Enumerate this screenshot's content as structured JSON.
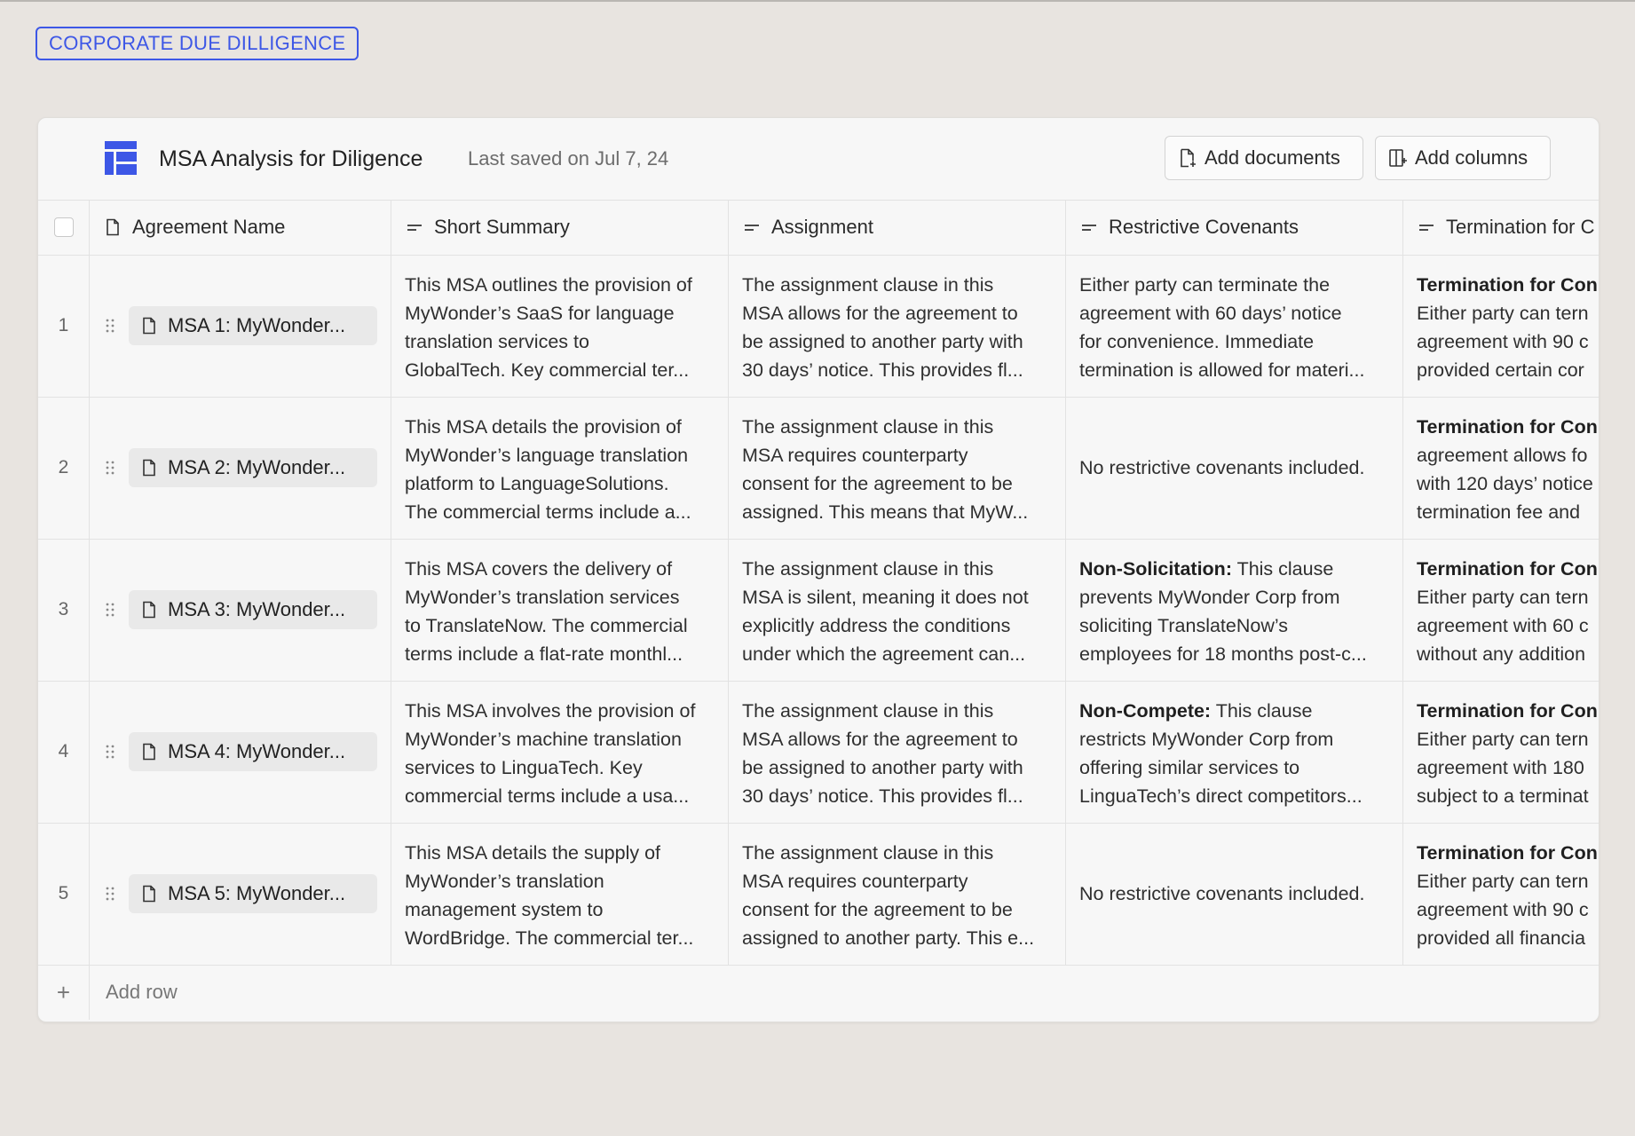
{
  "tag": "CORPORATE DUE DILLIGENCE",
  "header": {
    "title": "MSA Analysis for Diligence",
    "saved": "Last saved on Jul 7, 24",
    "add_documents": "Add documents",
    "add_columns": "Add columns"
  },
  "columns": {
    "agreement_name": "Agreement Name",
    "short_summary": "Short Summary",
    "assignment": "Assignment",
    "restrictive_covenants": "Restrictive Covenants",
    "termination": "Termination for C"
  },
  "rows": [
    {
      "num": "1",
      "name": "MSA 1: MyWonder...",
      "summary": [
        "This MSA outlines the provision of",
        "MyWonder’s SaaS for language",
        "translation services to",
        "GlobalTech. Key commercial ter..."
      ],
      "assignment": [
        "The assignment clause in this",
        "MSA allows for the agreement to",
        "be assigned to another party with",
        "30 days’ notice. This provides fl..."
      ],
      "covenants": [
        "Either party can terminate the",
        "agreement with 60 days’ notice",
        "for convenience. Immediate",
        "termination is allowed for materi..."
      ],
      "termination_bold": "Termination for Con",
      "termination": [
        "Either party can tern",
        "agreement with 90 c",
        "provided certain cor"
      ]
    },
    {
      "num": "2",
      "name": "MSA 2: MyWonder...",
      "summary": [
        "This MSA details the provision of",
        "MyWonder’s language translation",
        "platform to LanguageSolutions.",
        "The commercial terms include a..."
      ],
      "assignment": [
        "The assignment clause in this",
        "MSA requires counterparty",
        "consent for the agreement to be",
        "assigned. This means that MyW..."
      ],
      "covenants_single": "No restrictive covenants included.",
      "termination_bold": "Termination for Con",
      "termination": [
        "agreement allows fo",
        "with 120 days’ notice",
        "termination fee and"
      ]
    },
    {
      "num": "3",
      "name": "MSA 3: MyWonder...",
      "summary": [
        "This MSA covers the delivery of",
        "MyWonder’s translation services",
        "to TranslateNow. The commercial",
        "terms include a flat-rate monthl..."
      ],
      "assignment": [
        "The assignment clause in this",
        "MSA is silent, meaning it does not",
        "explicitly address the conditions",
        "under which the agreement can..."
      ],
      "covenants_bold": "Non-Solicitation:",
      "covenants_first": " This clause",
      "covenants": [
        "prevents MyWonder Corp from",
        "soliciting TranslateNow’s",
        "employees for 18 months post-c..."
      ],
      "termination_bold": "Termination for Con",
      "termination": [
        "Either party can tern",
        "agreement with 60 c",
        "without any addition"
      ]
    },
    {
      "num": "4",
      "name": "MSA 4: MyWonder...",
      "summary": [
        "This MSA involves the provision of",
        "MyWonder’s machine translation",
        "services to LinguaTech. Key",
        "commercial terms include a usa..."
      ],
      "assignment": [
        "The assignment clause in this",
        "MSA allows for the agreement to",
        "be assigned to another party with",
        "30 days’ notice. This provides fl..."
      ],
      "covenants_bold": "Non-Compete:",
      "covenants_first": " This clause",
      "covenants": [
        "restricts MyWonder Corp from",
        "offering similar services to",
        "LinguaTech’s direct competitors..."
      ],
      "termination_bold": "Termination for Con",
      "termination": [
        "Either party can tern",
        "agreement with 180",
        "subject to a terminat"
      ]
    },
    {
      "num": "5",
      "name": "MSA 5: MyWonder...",
      "summary": [
        "This MSA details the supply of",
        "MyWonder’s translation",
        "management system to",
        "WordBridge. The commercial ter..."
      ],
      "assignment": [
        "The assignment clause in this",
        "MSA requires counterparty",
        "consent for the agreement to be",
        "assigned to another party. This e..."
      ],
      "covenants_single": "No restrictive covenants included.",
      "termination_bold": "Termination for Con",
      "termination": [
        "Either party can tern",
        "agreement with 90 c",
        "provided all financia"
      ]
    }
  ],
  "add_row": {
    "plus": "+",
    "label": "Add row"
  },
  "colors": {
    "accent": "#3d57e6",
    "background": "#e8e4e0",
    "card": "#f7f7f7"
  }
}
